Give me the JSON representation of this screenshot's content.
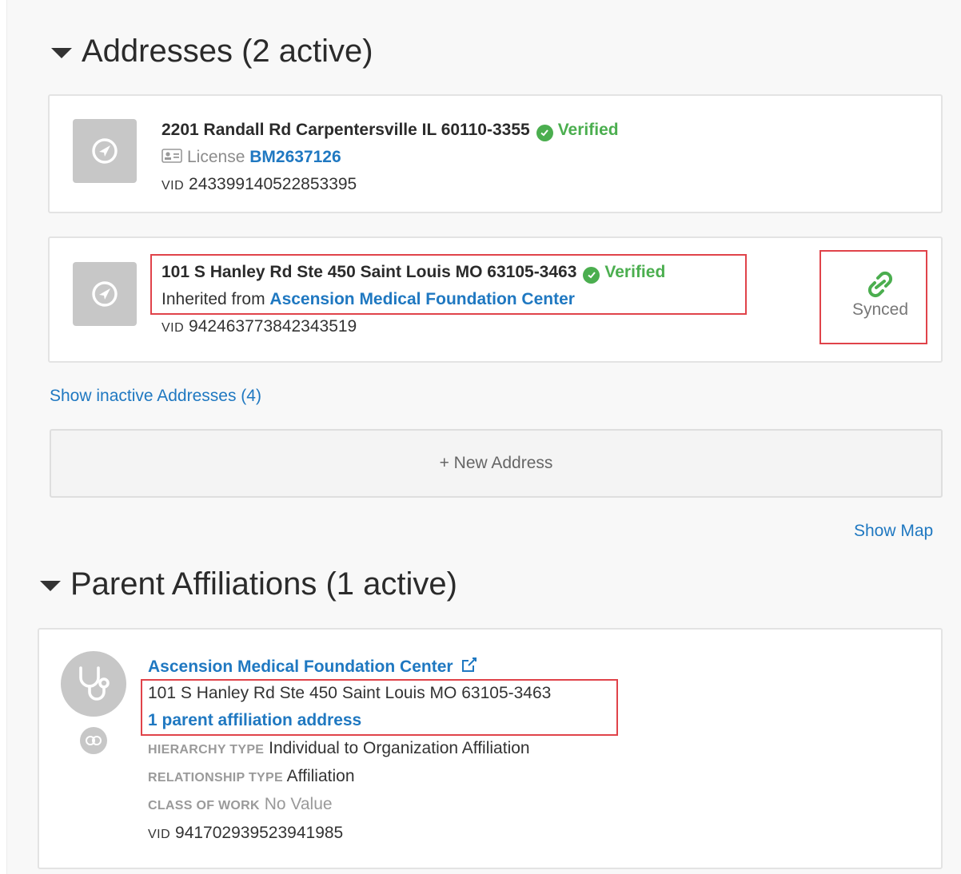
{
  "addresses": {
    "title": "Addresses (2 active)",
    "items": [
      {
        "address": "2201 Randall Rd Carpentersville IL 60110-3355",
        "status": "Verified",
        "license_label": "License",
        "license_value": "BM2637126",
        "vid_label": "VID",
        "vid": "243399140522853395"
      },
      {
        "address": "101 S Hanley Rd Ste 450 Saint Louis MO 63105-3463",
        "status": "Verified",
        "inherited_label": "Inherited from",
        "inherited_from": "Ascension Medical Foundation Center",
        "vid_label": "VID",
        "vid": "942463773842343519",
        "sync_label": "Synced"
      }
    ],
    "show_inactive": "Show inactive Addresses (4)",
    "new_address": "+ New Address",
    "show_map": "Show Map"
  },
  "affiliations": {
    "title": "Parent Affiliations (1 active)",
    "item": {
      "name": "Ascension Medical Foundation Center",
      "address": "101 S Hanley Rd Ste 450 Saint Louis MO 63105-3463",
      "parent_address_link": "1 parent affiliation address",
      "hierarchy_label": "HIERARCHY TYPE",
      "hierarchy_value": "Individual to Organization Affiliation",
      "relationship_label": "RELATIONSHIP TYPE",
      "relationship_value": "Affiliation",
      "class_label": "CLASS OF WORK",
      "class_value": "No Value",
      "vid_label": "VID",
      "vid": "941702939523941985"
    }
  },
  "colors": {
    "verified": "#4bae4f",
    "link": "#1f78c1",
    "highlight": "#e0434a"
  },
  "icons": [
    "caret-down-icon",
    "navigation-icon",
    "check-circle-icon",
    "license-card-icon",
    "link-chain-icon",
    "stethoscope-icon",
    "external-link-icon"
  ]
}
